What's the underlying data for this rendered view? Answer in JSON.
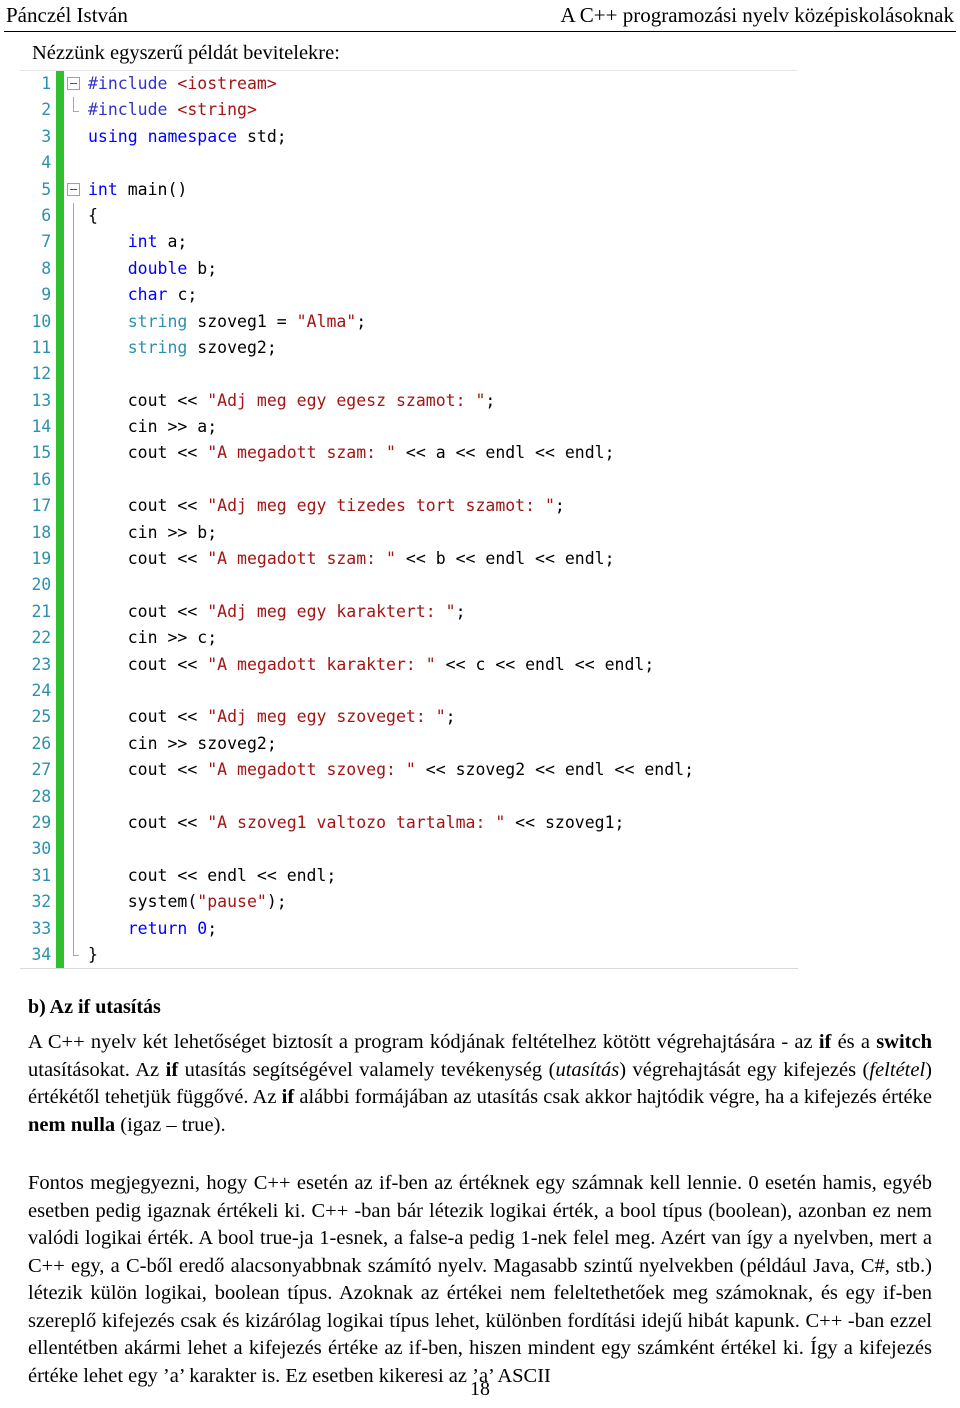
{
  "header": {
    "left": "Pánczél István",
    "right": "A C++ programozási nyelv középiskolásoknak"
  },
  "intro": "Nézzünk egyszerű példát bevitelekre:",
  "code": {
    "language": "C++",
    "colors": {
      "line_number": "#2b91af",
      "change_bar": "#2fbf2f",
      "keyword": "#0000ff",
      "preprocessor": "#3333cc",
      "type": "#2b91af",
      "string": "#a31515",
      "plain": "#000000",
      "outline_border": "#a0a0a0"
    },
    "lines": [
      {
        "n": "1",
        "outline": "collapse",
        "html": "<span class=\"pp\">#include</span> <span class=\"s\">&lt;iostream&gt;</span>"
      },
      {
        "n": "2",
        "outline": "end",
        "html": "<span class=\"pp\">#include</span> <span class=\"s\">&lt;string&gt;</span>"
      },
      {
        "n": "3",
        "outline": "none",
        "html": "<span class=\"k\">using</span> <span class=\"k\">namespace</span> <span class=\"n\">std;</span>"
      },
      {
        "n": "4",
        "outline": "none",
        "html": ""
      },
      {
        "n": "5",
        "outline": "collapse",
        "html": "<span class=\"k\">int</span> <span class=\"n\">main()</span>"
      },
      {
        "n": "6",
        "outline": "line",
        "html": "<span class=\"n\">{</span>"
      },
      {
        "n": "7",
        "outline": "line",
        "html": "    <span class=\"k\">int</span> <span class=\"n\">a;</span>"
      },
      {
        "n": "8",
        "outline": "line",
        "html": "    <span class=\"k\">double</span> <span class=\"n\">b;</span>"
      },
      {
        "n": "9",
        "outline": "line",
        "html": "    <span class=\"k\">char</span> <span class=\"n\">c;</span>"
      },
      {
        "n": "10",
        "outline": "line",
        "html": "    <span class=\"ty\">string</span> <span class=\"n\">szoveg1 = </span><span class=\"s\">\"Alma\"</span><span class=\"n\">;</span>"
      },
      {
        "n": "11",
        "outline": "line",
        "html": "    <span class=\"ty\">string</span> <span class=\"n\">szoveg2;</span>"
      },
      {
        "n": "12",
        "outline": "line",
        "html": ""
      },
      {
        "n": "13",
        "outline": "line",
        "html": "    <span class=\"n\">cout &lt;&lt; </span><span class=\"s\">\"Adj meg egy egesz szamot: \"</span><span class=\"n\">;</span>"
      },
      {
        "n": "14",
        "outline": "line",
        "html": "    <span class=\"n\">cin &gt;&gt; a;</span>"
      },
      {
        "n": "15",
        "outline": "line",
        "html": "    <span class=\"n\">cout &lt;&lt; </span><span class=\"s\">\"A megadott szam: \"</span><span class=\"n\"> &lt;&lt; a &lt;&lt; endl &lt;&lt; endl;</span>"
      },
      {
        "n": "16",
        "outline": "line",
        "html": ""
      },
      {
        "n": "17",
        "outline": "line",
        "html": "    <span class=\"n\">cout &lt;&lt; </span><span class=\"s\">\"Adj meg egy tizedes tort szamot: \"</span><span class=\"n\">;</span>"
      },
      {
        "n": "18",
        "outline": "line",
        "html": "    <span class=\"n\">cin &gt;&gt; b;</span>"
      },
      {
        "n": "19",
        "outline": "line",
        "html": "    <span class=\"n\">cout &lt;&lt; </span><span class=\"s\">\"A megadott szam: \"</span><span class=\"n\"> &lt;&lt; b &lt;&lt; endl &lt;&lt; endl;</span>"
      },
      {
        "n": "20",
        "outline": "line",
        "html": ""
      },
      {
        "n": "21",
        "outline": "line",
        "html": "    <span class=\"n\">cout &lt;&lt; </span><span class=\"s\">\"Adj meg egy karaktert: \"</span><span class=\"n\">;</span>"
      },
      {
        "n": "22",
        "outline": "line",
        "html": "    <span class=\"n\">cin &gt;&gt; c;</span>"
      },
      {
        "n": "23",
        "outline": "line",
        "html": "    <span class=\"n\">cout &lt;&lt; </span><span class=\"s\">\"A megadott karakter: \"</span><span class=\"n\"> &lt;&lt; c &lt;&lt; endl &lt;&lt; endl;</span>"
      },
      {
        "n": "24",
        "outline": "line",
        "html": ""
      },
      {
        "n": "25",
        "outline": "line",
        "html": "    <span class=\"n\">cout &lt;&lt; </span><span class=\"s\">\"Adj meg egy szoveget: \"</span><span class=\"n\">;</span>"
      },
      {
        "n": "26",
        "outline": "line",
        "html": "    <span class=\"n\">cin &gt;&gt; szoveg2;</span>"
      },
      {
        "n": "27",
        "outline": "line",
        "html": "    <span class=\"n\">cout &lt;&lt; </span><span class=\"s\">\"A megadott szoveg: \"</span><span class=\"n\"> &lt;&lt; szoveg2 &lt;&lt; endl &lt;&lt; endl;</span>"
      },
      {
        "n": "28",
        "outline": "line",
        "html": ""
      },
      {
        "n": "29",
        "outline": "line",
        "html": "    <span class=\"n\">cout &lt;&lt; </span><span class=\"s\">\"A szoveg1 valtozo tartalma: \"</span><span class=\"n\"> &lt;&lt; szoveg1;</span>"
      },
      {
        "n": "30",
        "outline": "line",
        "html": ""
      },
      {
        "n": "31",
        "outline": "line",
        "html": "    <span class=\"n\">cout &lt;&lt; endl &lt;&lt; endl;</span>"
      },
      {
        "n": "32",
        "outline": "line",
        "html": "    <span class=\"n\">system(</span><span class=\"s\">\"pause\"</span><span class=\"n\">);</span>"
      },
      {
        "n": "33",
        "outline": "line",
        "html": "    <span class=\"k\">return</span> <span class=\"num\">0</span><span class=\"n\">;</span>"
      },
      {
        "n": "34",
        "outline": "end",
        "html": "<span class=\"n\">}</span>"
      }
    ]
  },
  "section": {
    "heading": "b) Az if utasítás",
    "paragraph1_html": "A C++ nyelv két lehetőséget biztosít a program kódjának feltételhez kötött végrehajtására - az <b>if</b> és a <b>switch</b> utasításokat. Az <b>if</b> utasítás segítségével valamely tevékenység (<i>utasítás</i>) végrehajtását egy kifejezés (<i>feltétel</i>) értékétől tehetjük függővé. Az <b>if</b> alábbi formájában az utasítás csak akkor hajtódik végre, ha a kifejezés értéke <b>nem nulla</b> (igaz &ndash; true).",
    "paragraph2_html": "Fontos megjegyezni, hogy C++ esetén az if-ben az értéknek egy számnak kell lennie. 0 esetén hamis, egyéb esetben pedig igaznak értékeli ki. C++ -ban bár létezik logikai érték, a bool típus (boolean), azonban ez nem valódi logikai érték. A bool true-ja 1-esnek, a false-a pedig 1-nek felel meg. Azért van így a nyelvben, mert a C++ egy, a C-ből eredő alacsonyabbnak számító nyelv. Magasabb szintű nyelvekben (például Java, C#, stb.) létezik külön logikai, boolean típus. Azoknak az értékei nem feleltethetőek meg számoknak, és egy if-ben szereplő kifejezés csak és kizárólag logikai típus lehet, különben fordítási idejű hibát kapunk. C++ -ban ezzel ellentétben akármi lehet a kifejezés értéke az if-ben, hiszen mindent egy számként értékel ki. Így a kifejezés értéke lehet egy &rsquo;a&rsquo; karakter is. Ez esetben kikeresi az &rsquo;a&rsquo; ASCII"
  },
  "page_number": "18"
}
